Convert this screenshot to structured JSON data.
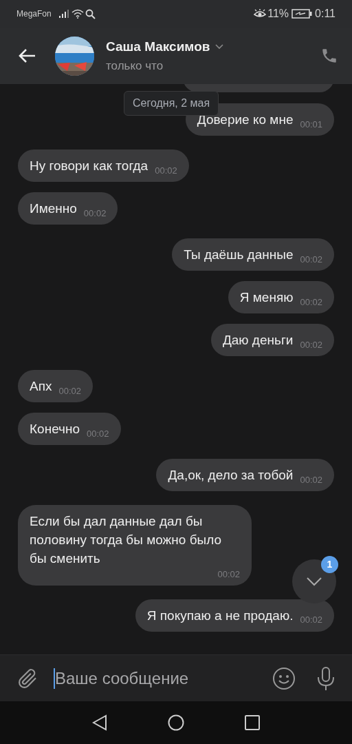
{
  "status_bar": {
    "carrier": "MegaFon",
    "battery_percent": "11%",
    "time": "0:11"
  },
  "header": {
    "name": "Саша Максимов",
    "status": "только что"
  },
  "date_separator": "Сегодня, 2 мая",
  "messages": [
    {
      "kind": "outgoing",
      "text": "Доверие ко мне",
      "time": "00:01"
    },
    {
      "kind": "incoming",
      "text": "Ну говори как тогда",
      "time": "00:02"
    },
    {
      "kind": "incoming",
      "text": "Именно",
      "time": "00:02"
    },
    {
      "kind": "outgoing",
      "text": "Ты даёшь данные",
      "time": "00:02"
    },
    {
      "kind": "outgoing",
      "text": "Я меняю",
      "time": "00:02"
    },
    {
      "kind": "outgoing",
      "text": "Даю деньги",
      "time": "00:02"
    },
    {
      "kind": "incoming",
      "text": "Апх",
      "time": "00:02"
    },
    {
      "kind": "incoming",
      "text": "Конечно",
      "time": "00:02"
    },
    {
      "kind": "outgoing",
      "text": "Да,ок, дело за тобой",
      "time": "00:02"
    },
    {
      "kind": "incoming",
      "text": "Если бы дал данные дал бы половину тогда бы можно было бы сменить",
      "time": "00:02"
    },
    {
      "kind": "outgoing",
      "text": "Я покупаю а не продаю.",
      "time": "00:02"
    }
  ],
  "scroll_down": {
    "badge": "1"
  },
  "composer": {
    "placeholder": "Ваше сообщение"
  }
}
